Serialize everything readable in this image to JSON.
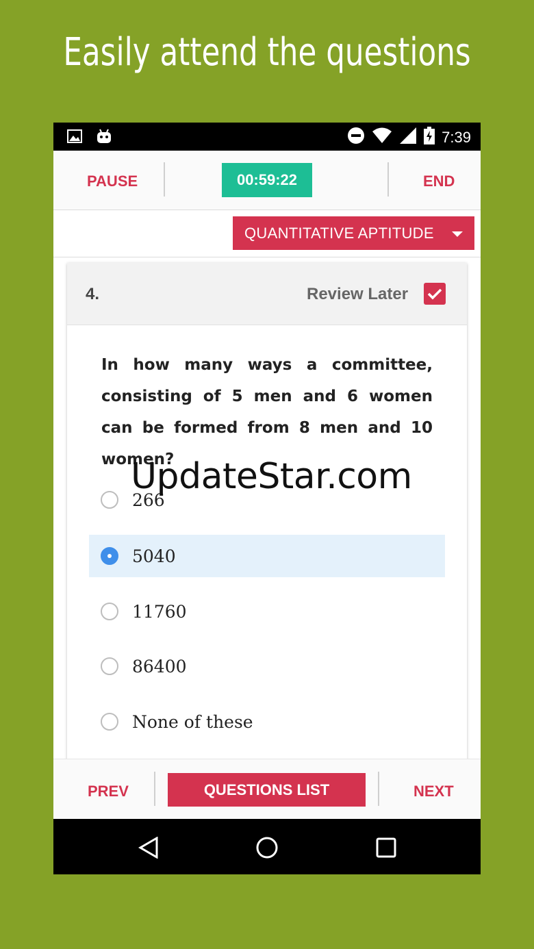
{
  "headline": "Easily attend the questions",
  "status_bar": {
    "time": "7:39",
    "icons": [
      "image-icon",
      "android-icon",
      "dnd-icon",
      "wifi-icon",
      "signal-icon",
      "battery-icon"
    ]
  },
  "top_bar": {
    "pause_label": "PAUSE",
    "timer": "00:59:22",
    "end_label": "END"
  },
  "section": {
    "selected": "QUANTITATIVE APTITUDE"
  },
  "question": {
    "number": "4.",
    "review_label": "Review Later",
    "review_checked": true,
    "text": "In how many ways a committee, consisting of 5 men and 6 women can be formed from 8 men and 10 women?",
    "options": [
      {
        "label": "266",
        "selected": false
      },
      {
        "label": "5040",
        "selected": true
      },
      {
        "label": "11760",
        "selected": false
      },
      {
        "label": "86400",
        "selected": false
      },
      {
        "label": "None of these",
        "selected": false
      }
    ]
  },
  "watermark": "UpdateStar.com",
  "bottom_bar": {
    "prev_label": "PREV",
    "questions_list_label": "QUESTIONS LIST",
    "next_label": "NEXT"
  },
  "colors": {
    "background": "#85A227",
    "accent": "#D4334F",
    "timer": "#1DBE95",
    "selected_option_bg": "#E4F1FB",
    "radio_on": "#3F8FEA"
  }
}
